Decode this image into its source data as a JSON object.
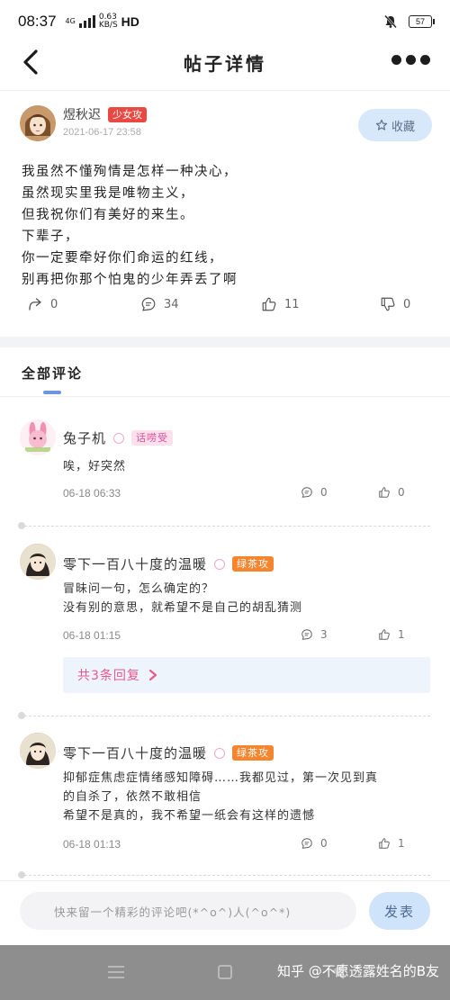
{
  "status_bar": {
    "time": "08:37",
    "network": "4G",
    "speed_value": "0.63",
    "speed_unit": "KB/S",
    "hd": "HD",
    "battery": "57"
  },
  "header": {
    "title": "帖子详情",
    "back_icon": "chevron-left-icon",
    "more_icon": "more-dots-icon"
  },
  "post": {
    "author": "煜秋迟",
    "badge": "少女攻",
    "date": "2021-06-17 23:58",
    "favorite_label": "收藏",
    "body_lines": [
      "我虽然不懂殉情是怎样一种决心，",
      "虽然现实里我是唯物主义，",
      "但我祝你们有美好的来生。",
      "下辈子，",
      "你一定要牵好你们命运的红线，",
      "别再把你那个怕鬼的少年弄丢了啊"
    ],
    "actions": {
      "share_count": "0",
      "comment_count": "34",
      "like_count": "11",
      "dislike_count": "0"
    }
  },
  "comments_section": {
    "title": "全部评论",
    "comments": [
      {
        "name": "兔子机",
        "badge": "话唠受",
        "lines": [
          "唉，好突然"
        ],
        "time": "06-18 06:33",
        "reply_count": "0",
        "like_count": "0"
      },
      {
        "name": "零下一百八十度的温暖",
        "badge": "绿茶攻",
        "lines": [
          "冒昧问一句，怎么确定的？",
          "没有别的意思，就希望不是自己的胡乱猜测"
        ],
        "time": "06-18 01:15",
        "reply_count": "3",
        "like_count": "1",
        "replies_link": "共3条回复"
      },
      {
        "name": "零下一百八十度的温暖",
        "badge": "绿茶攻",
        "lines": [
          "抑郁症焦虑症情绪感知障碍……我都见过，第一次见到真",
          "的自杀了，依然不敢相信",
          "希望不是真的，我不希望一纸会有这样的遗憾"
        ],
        "time": "06-18 01:13",
        "reply_count": "0",
        "like_count": "1"
      }
    ]
  },
  "input_bar": {
    "placeholder": "快来留一个精彩的评论吧(*^o^)人(^o^*)",
    "send_label": "发表"
  },
  "watermark": "知乎 @不愿透露姓名的B友"
}
